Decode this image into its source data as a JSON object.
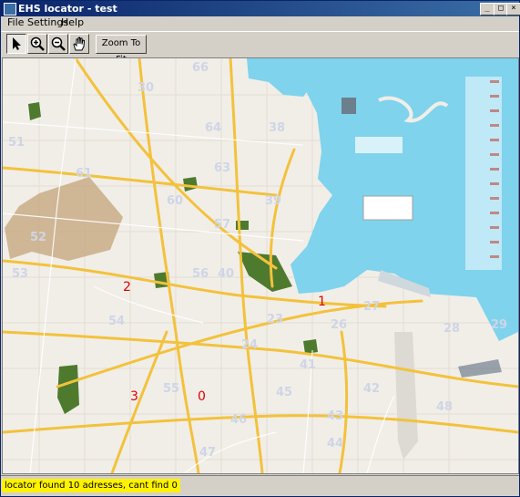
{
  "window": {
    "title": "EHS locator - test",
    "minimize": "_",
    "maximize": "□",
    "close": "×"
  },
  "menu": [
    "File",
    "Settings",
    "Help"
  ],
  "toolbar": {
    "zoom_to_fit_label": "Zoom To Fit",
    "tools": [
      "select-arrow-icon",
      "zoom-in-icon",
      "zoom-out-icon",
      "pan-hand-icon"
    ],
    "active_tool": "select-arrow-icon"
  },
  "map": {
    "zone_labels": [
      "66",
      "30",
      "51",
      "61",
      "60",
      "52",
      "53",
      "54",
      "55",
      "56",
      "57",
      "23",
      "24",
      "26",
      "27",
      "28",
      "29",
      "42",
      "43",
      "44",
      "45",
      "46",
      "47",
      "48",
      "63",
      "64",
      "38",
      "39",
      "40",
      "41"
    ],
    "location_markers": [
      "1",
      "2",
      "3",
      "0"
    ],
    "colors": {
      "water": "#7fd3ec",
      "land": "#f1eee8",
      "road": "#f3c23c",
      "park": "#4e7a2e",
      "sand": "#c9ab86",
      "marker": "#e00000",
      "zone_label": "#cfd5e6"
    }
  },
  "status": {
    "text": "locator found 10 adresses, cant find 0",
    "highlight": "#fff200"
  }
}
